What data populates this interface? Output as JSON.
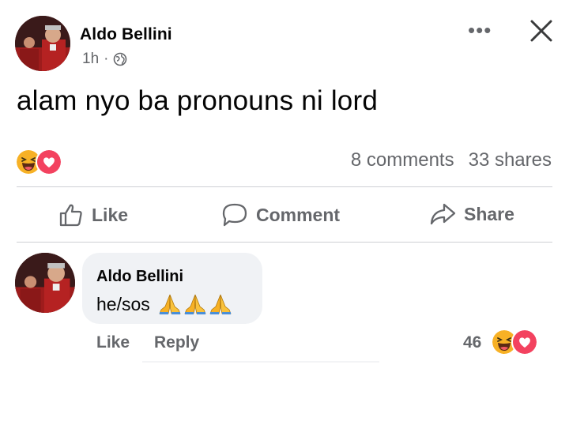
{
  "post": {
    "author": "Aldo Bellini",
    "time": "1h",
    "separator": "·",
    "visibility_icon": "globe-icon",
    "text": "alam nyo ba pronouns ni lord",
    "reactions": [
      "haha-emoji-icon",
      "love-heart-icon"
    ],
    "comments_count": "8 comments",
    "shares_count": "33 shares"
  },
  "header": {
    "more_icon": "more-dots-icon",
    "more_text": "•••",
    "close_icon": "close-icon"
  },
  "actions": {
    "like": "Like",
    "comment": "Comment",
    "share": "Share"
  },
  "comment": {
    "author": "Aldo Bellini",
    "text": "he/sos",
    "emoji": [
      "folded-hands-icon",
      "folded-hands-icon",
      "folded-hands-icon"
    ],
    "like": "Like",
    "reply": "Reply",
    "reaction_count": "46",
    "reactions": [
      "haha-emoji-icon",
      "love-heart-icon"
    ]
  },
  "colors": {
    "text": "#050505",
    "secondary": "#65676b",
    "bubble": "#f0f2f5",
    "divider": "#ced0d4",
    "love": "#f3425f",
    "haha": "#f7b125"
  }
}
